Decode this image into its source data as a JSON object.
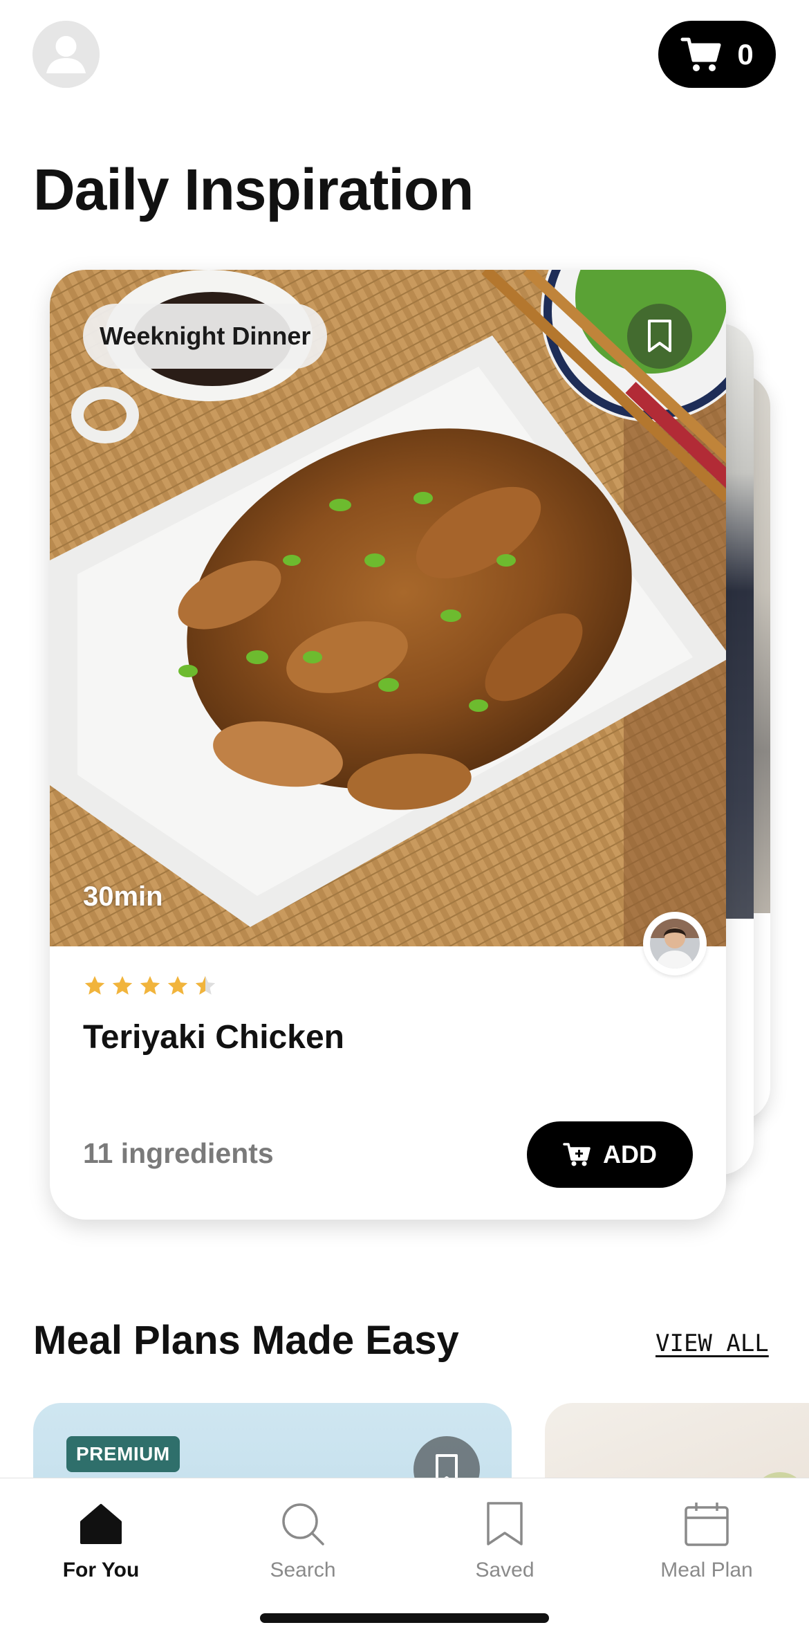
{
  "header": {
    "profile_icon": "person-icon",
    "cart_icon": "cart-icon",
    "cart_count": "0"
  },
  "page_title": "Daily Inspiration",
  "featured_card": {
    "tag": "Weeknight Dinner",
    "time": "30min",
    "rating": 4.5,
    "rating_max": 5,
    "title": "Teriyaki Chicken",
    "ingredients": "11 ingredients",
    "add_label": "ADD",
    "icons": {
      "bookmark": "bookmark-icon",
      "chef": "chef-avatar",
      "add_to_cart": "cart-plus-icon"
    }
  },
  "meal_plans": {
    "title": "Meal Plans Made Easy",
    "view_all": "VIEW ALL",
    "card_badge": "PREMIUM"
  },
  "tabbar": {
    "items": [
      {
        "label": "For You",
        "icon": "home-icon",
        "active": true
      },
      {
        "label": "Search",
        "icon": "search-icon",
        "active": false
      },
      {
        "label": "Saved",
        "icon": "bookmark-icon",
        "active": false
      },
      {
        "label": "Meal Plan",
        "icon": "calendar-icon",
        "active": false
      }
    ]
  },
  "colors": {
    "accent": "#000000",
    "star": "#f1b43c",
    "premium_badge": "#2f6f6b",
    "inactive_tab": "#8a8a8a"
  }
}
